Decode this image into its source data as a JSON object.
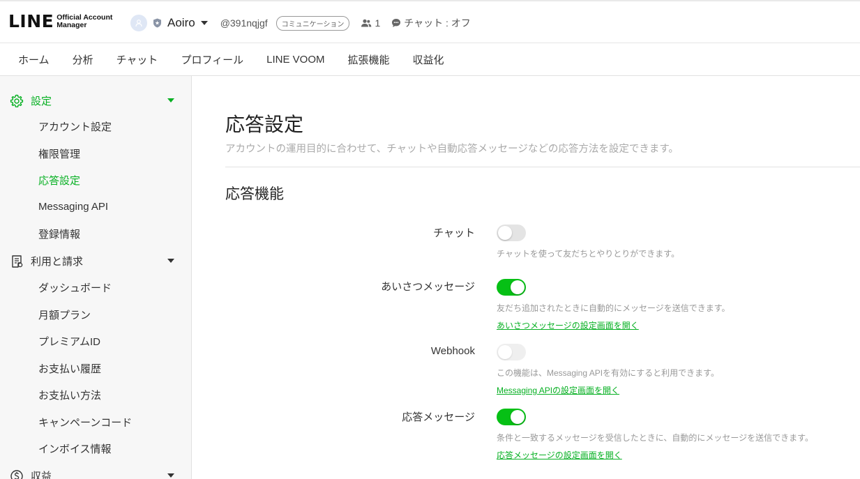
{
  "header": {
    "logo_text": "LINE",
    "logo_sub_1": "Official Account",
    "logo_sub_2": "Manager",
    "account_name": "Aoiro",
    "account_id": "@391nqjgf",
    "plan_badge": "コミュニケーション",
    "friend_count": "1",
    "chat_status": "チャット : オフ"
  },
  "nav": {
    "items": [
      "ホーム",
      "分析",
      "チャット",
      "プロフィール",
      "LINE VOOM",
      "拡張機能",
      "収益化"
    ]
  },
  "sidebar": {
    "settings_label": "設定",
    "settings_items": [
      "アカウント設定",
      "権限管理",
      "応答設定",
      "Messaging API",
      "登録情報"
    ],
    "billing_label": "利用と請求",
    "billing_items": [
      "ダッシュボード",
      "月額プラン",
      "プレミアムID",
      "お支払い履歴",
      "お支払い方法",
      "キャンペーンコード",
      "インボイス情報"
    ],
    "revenue_label": "収益"
  },
  "main": {
    "title": "応答設定",
    "description": "アカウントの運用目的に合わせて、チャットや自動応答メッセージなどの応答方法を設定できます。",
    "section_title": "応答機能",
    "rows": [
      {
        "label": "チャット",
        "state": "off",
        "desc": "チャットを使って友だちとやりとりができます。",
        "link": ""
      },
      {
        "label": "あいさつメッセージ",
        "state": "on",
        "desc": "友だち追加されたときに自動的にメッセージを送信できます。",
        "link": "あいさつメッセージの設定画面を開く"
      },
      {
        "label": "Webhook",
        "state": "disabled",
        "desc": "この機能は、Messaging APIを有効にすると利用できます。",
        "link": "Messaging APIの設定画面を開く"
      },
      {
        "label": "応答メッセージ",
        "state": "on",
        "desc": "条件と一致するメッセージを受信したときに、自動的にメッセージを送信できます。",
        "link": "応答メッセージの設定画面を開く"
      }
    ]
  },
  "colors": {
    "accent": "#06b022",
    "toggle_on": "#06c015"
  }
}
